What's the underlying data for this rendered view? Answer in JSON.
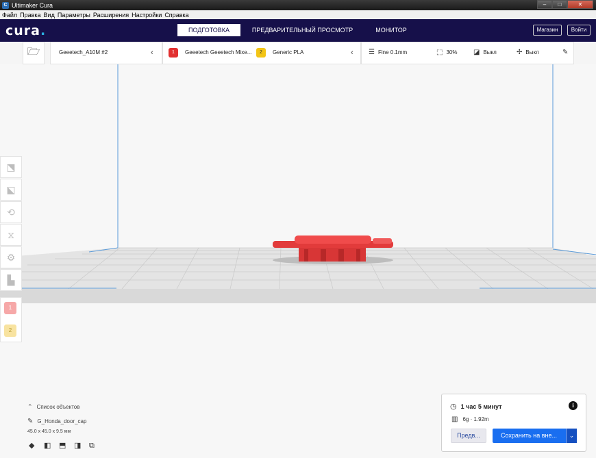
{
  "window": {
    "title": "Ultimaker Cura",
    "app_icon": "C"
  },
  "menubar": {
    "items": [
      "Файл",
      "Правка",
      "Вид",
      "Параметры",
      "Расширения",
      "Настройки",
      "Справка"
    ]
  },
  "header": {
    "logo": "cura",
    "tabs": [
      {
        "label": "ПОДГОТОВКА",
        "active": true
      },
      {
        "label": "ПРЕДВАРИТЕЛЬНЫЙ ПРОСМОТР",
        "active": false
      },
      {
        "label": "МОНИТОР",
        "active": false
      }
    ],
    "marketplace_label": "Магазин",
    "login_label": "Войти"
  },
  "stage": {
    "machine_name": "Geeetech_A10M #2",
    "extruder1": {
      "index": "1",
      "name": "Geeetech Geeetech Mixe...",
      "color": "#e23030"
    },
    "extruder2": {
      "index": "2",
      "name": "Generic PLA",
      "color": "#f3c516"
    },
    "profile": "Fine 0.1mm",
    "infill": "30%",
    "support": "Выкл",
    "adhesion": "Выкл"
  },
  "tools": [
    "move-icon",
    "scale-icon",
    "rotate-icon",
    "mirror-icon",
    "per-model-settings-icon",
    "support-blocker-icon"
  ],
  "extruder_badges": [
    {
      "label": "1",
      "color": "#f6a8a8"
    },
    {
      "label": "2",
      "color": "#f8e3a0"
    }
  ],
  "objects": {
    "header": "Список объектов",
    "filename": "G_Honda_door_cap",
    "dimensions": "45.0 x 45.0 x 9.5 мм"
  },
  "print": {
    "time": "1 час 5 минут",
    "material": "6g · 1.92m",
    "preview_label": "Предв...",
    "save_label": "Сохранить на вне...",
    "accent": "#196ef0"
  },
  "colors": {
    "header_bg": "#16104a",
    "model_red": "#f04b4b",
    "buildplate": "#e8e8e8"
  }
}
